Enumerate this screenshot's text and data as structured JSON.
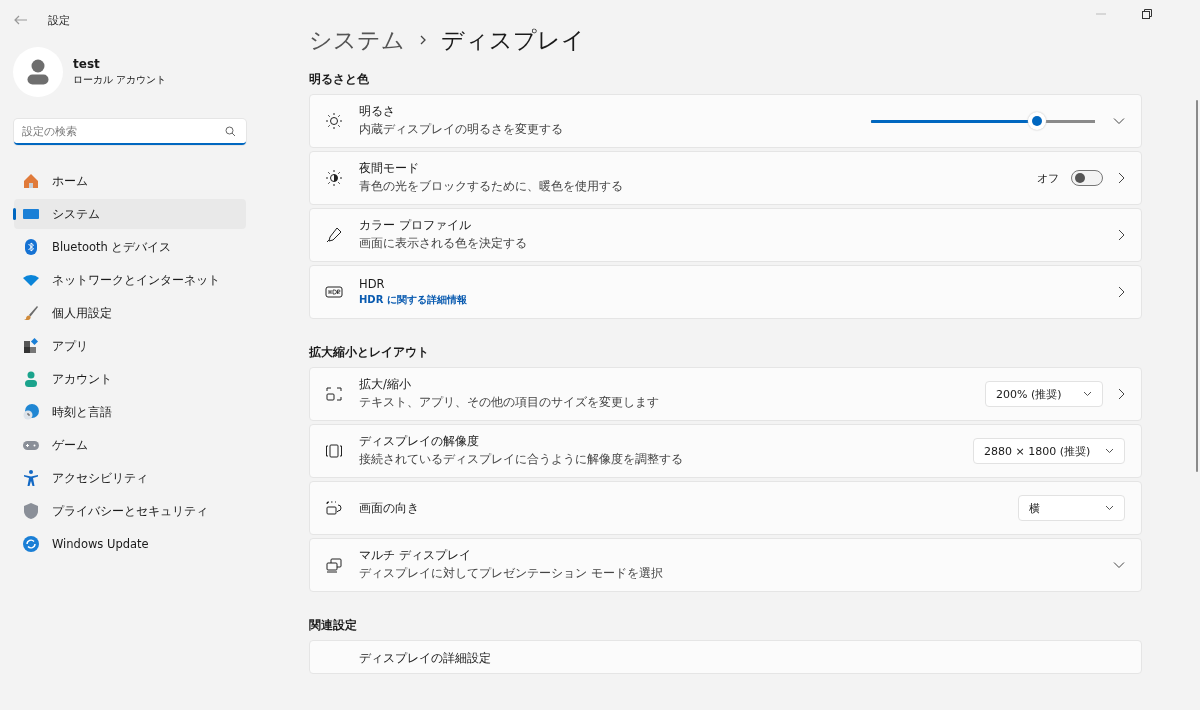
{
  "window": {
    "title": "設定"
  },
  "account": {
    "name": "test",
    "type": "ローカル アカウント"
  },
  "search": {
    "placeholder": "設定の検索"
  },
  "nav": [
    {
      "label": "ホーム",
      "selected": false
    },
    {
      "label": "システム",
      "selected": true
    },
    {
      "label": "Bluetooth とデバイス",
      "selected": false
    },
    {
      "label": "ネットワークとインターネット",
      "selected": false
    },
    {
      "label": "個人用設定",
      "selected": false
    },
    {
      "label": "アプリ",
      "selected": false
    },
    {
      "label": "アカウント",
      "selected": false
    },
    {
      "label": "時刻と言語",
      "selected": false
    },
    {
      "label": "ゲーム",
      "selected": false
    },
    {
      "label": "アクセシビリティ",
      "selected": false
    },
    {
      "label": "プライバシーとセキュリティ",
      "selected": false
    },
    {
      "label": "Windows Update",
      "selected": false
    }
  ],
  "breadcrumb": {
    "parent": "システム",
    "current": "ディスプレイ"
  },
  "sections": [
    {
      "title": "明るさと色",
      "rows": [
        {
          "kind": "slider",
          "title": "明るさ",
          "subtitle": "内蔵ディスプレイの明るさを変更する",
          "level": 0.74
        },
        {
          "kind": "toggle",
          "title": "夜間モード",
          "subtitle": "青色の光をブロックするために、暖色を使用する",
          "on": false,
          "state_label": "オフ"
        },
        {
          "kind": "link",
          "title": "カラー プロファイル",
          "subtitle": "画面に表示される色を決定する"
        },
        {
          "kind": "link",
          "title": "HDR",
          "link": "HDR に関する詳細情報"
        }
      ]
    },
    {
      "title": "拡大縮小とレイアウト",
      "rows": [
        {
          "kind": "dropdown-link",
          "title": "拡大/縮小",
          "subtitle": "テキスト、アプリ、その他の項目のサイズを変更します",
          "value": "200% (推奨)"
        },
        {
          "kind": "dropdown",
          "title": "ディスプレイの解像度",
          "subtitle": "接続されているディスプレイに合うように解像度を調整する",
          "value": "2880 × 1800 (推奨)"
        },
        {
          "kind": "dropdown",
          "title": "画面の向き",
          "value": "横"
        },
        {
          "kind": "expand",
          "title": "マルチ ディスプレイ",
          "subtitle": "ディスプレイに対してプレゼンテーション モードを選択"
        }
      ]
    },
    {
      "title": "関連設定",
      "rows": [
        {
          "kind": "cut",
          "title": "ディスプレイの詳細設定"
        }
      ]
    }
  ]
}
